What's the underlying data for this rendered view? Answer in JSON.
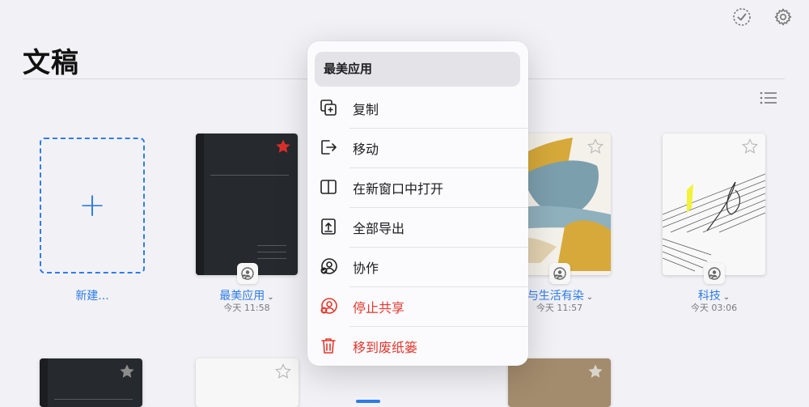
{
  "header": {
    "title": "文稿"
  },
  "new_doc": {
    "plus": "+",
    "label": "新建..."
  },
  "documents": [
    {
      "name": "最美应用",
      "date": "今天 11:58",
      "starred": true
    },
    {
      "name": "与生活有染",
      "date": "今天 11:57",
      "starred": false
    },
    {
      "name": "科技",
      "date": "今天 03:06",
      "starred": false
    }
  ],
  "chevron": "⌄",
  "context_menu": {
    "title": "最美应用",
    "items": [
      {
        "label": "复制",
        "icon": "duplicate-icon",
        "danger": false
      },
      {
        "label": "移动",
        "icon": "move-icon",
        "danger": false
      },
      {
        "label": "在新窗口中打开",
        "icon": "split-window-icon",
        "danger": false
      },
      {
        "label": "全部导出",
        "icon": "export-icon",
        "danger": false
      },
      {
        "label": "协作",
        "icon": "collaborate-icon",
        "danger": false
      },
      {
        "label": "停止共享",
        "icon": "stop-sharing-icon",
        "danger": true
      },
      {
        "label": "移到废纸篓",
        "icon": "trash-icon",
        "danger": true
      }
    ]
  },
  "colors": {
    "accent": "#2e7ce6",
    "danger": "#e0382e",
    "star": "#d9302b"
  }
}
